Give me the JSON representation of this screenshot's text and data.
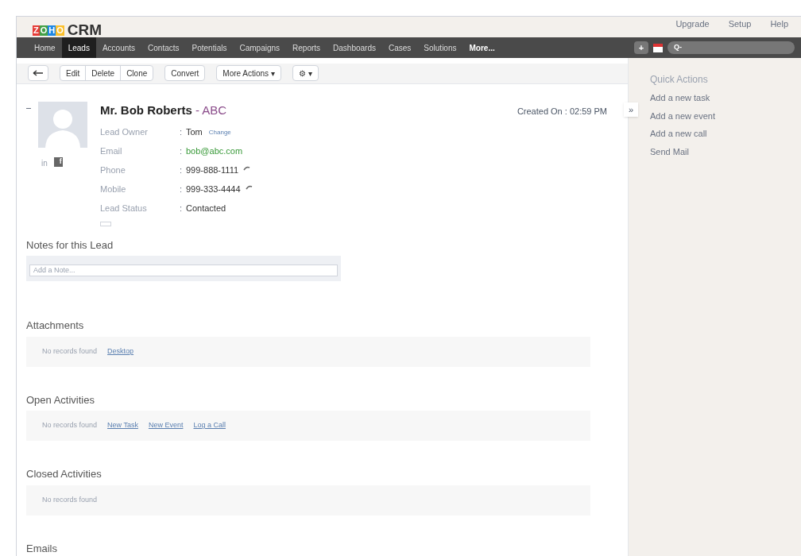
{
  "header": {
    "logo": "ZOHO",
    "product": "CRM",
    "top_links": [
      "Upgrade",
      "Setup",
      "Help"
    ]
  },
  "nav": {
    "tabs": [
      {
        "label": "Home",
        "selected": false
      },
      {
        "label": "Leads",
        "selected": true
      },
      {
        "label": "Accounts",
        "selected": false
      },
      {
        "label": "Contacts",
        "selected": false
      },
      {
        "label": "Potentials",
        "selected": false
      },
      {
        "label": "Campaigns",
        "selected": false
      },
      {
        "label": "Reports",
        "selected": false
      },
      {
        "label": "Dashboards",
        "selected": false
      },
      {
        "label": "Cases",
        "selected": false
      },
      {
        "label": "Solutions",
        "selected": false
      },
      {
        "label": "More...",
        "selected": false
      }
    ],
    "add_label": "+",
    "search_label": "Q-"
  },
  "toolbar": {
    "groups": [
      [
        "Edit",
        "Delete",
        "Clone"
      ],
      [
        "Convert"
      ],
      [
        "More Actions ▾"
      ],
      [
        "⚙ ▾"
      ]
    ]
  },
  "record": {
    "separator": ":",
    "name": "Mr. Bob Roberts",
    "company": "- ABC",
    "created": "Created On : 02:59 PM",
    "social": [
      "in",
      "f"
    ],
    "fields": [
      {
        "label": "Lead Owner",
        "value": "Tom",
        "kind": "owner",
        "link": "Change"
      },
      {
        "label": "Email",
        "value": "bob@abc.com",
        "kind": "email"
      },
      {
        "label": "Phone",
        "value": "999-888-1111",
        "kind": "phone"
      },
      {
        "label": "Mobile",
        "value": "999-333-4444",
        "kind": "phone"
      },
      {
        "label": "Lead Status",
        "value": "Contacted",
        "kind": "text"
      }
    ]
  },
  "notes": {
    "title": "Notes for this Lead",
    "placeholder": "Add a Note..."
  },
  "sections": [
    {
      "title": "Attachments",
      "empty": "No records found",
      "links": [
        "Desktop"
      ]
    },
    {
      "title": "Open Activities",
      "empty": "No records found",
      "links": [
        "New Task",
        "New Event",
        "Log a Call"
      ]
    },
    {
      "title": "Closed Activities",
      "empty": "No records found"
    },
    {
      "title": "Emails"
    }
  ],
  "quick_actions": {
    "toggle": "»",
    "title": "Quick Actions",
    "items": [
      "Add a new task",
      "Add a new event",
      "Add a new call",
      "Send Mail"
    ]
  }
}
